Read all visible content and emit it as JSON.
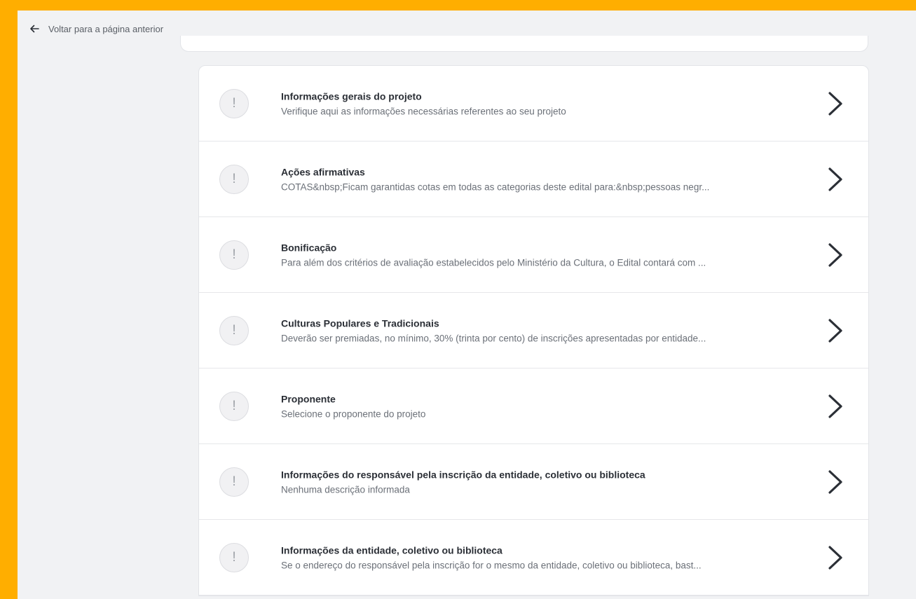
{
  "nav": {
    "back_label": "Voltar para a página anterior",
    "back_icon": "arrow-left-icon"
  },
  "colors": {
    "frame": "#FFAE00",
    "background": "#F1F2F4",
    "card": "#FFFFFF",
    "status_icon": "#9CA0A6"
  },
  "sections": [
    {
      "title": "Informações gerais do projeto",
      "description": "Verifique aqui as informações necessárias referentes ao seu projeto",
      "status_glyph": "!"
    },
    {
      "title": "Ações afirmativas",
      "description": "COTAS&nbsp;Ficam garantidas cotas em todas as categorias deste edital para:&nbsp;pessoas negr...",
      "status_glyph": "!"
    },
    {
      "title": "Bonificação",
      "description": "Para além dos critérios de avaliação estabelecidos pelo Ministério da Cultura, o Edital contará com ...",
      "status_glyph": "!"
    },
    {
      "title": "Culturas Populares e Tradicionais",
      "description": "Deverão ser premiadas, no mínimo, 30% (trinta por cento) de inscrições apresentadas por entidade...",
      "status_glyph": "!"
    },
    {
      "title": "Proponente",
      "description": "Selecione o proponente do projeto",
      "status_glyph": "!"
    },
    {
      "title": "Informações do responsável pela inscrição da entidade, coletivo ou biblioteca",
      "description": "Nenhuma descrição informada",
      "status_glyph": "!"
    },
    {
      "title": "Informações da entidade, coletivo ou biblioteca",
      "description": "Se o endereço do responsável pela inscrição for o mesmo da entidade, coletivo ou biblioteca, bast...",
      "status_glyph": "!"
    }
  ]
}
